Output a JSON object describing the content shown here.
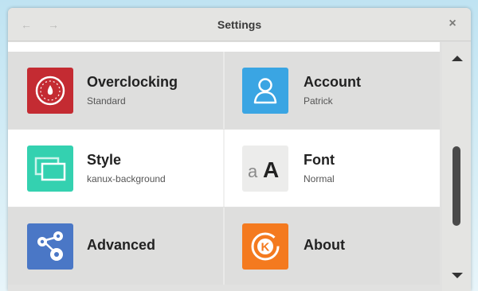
{
  "window": {
    "title": "Settings",
    "back_icon": "back-arrow-icon",
    "forward_icon": "forward-arrow-icon",
    "close_icon": "close-icon"
  },
  "items": [
    {
      "label": "Overclocking",
      "subtitle": "Standard",
      "icon": "speedometer-icon",
      "color": "#c42b32"
    },
    {
      "label": "Account",
      "subtitle": "Patrick",
      "icon": "user-icon",
      "color": "#3aa5e3"
    },
    {
      "label": "Style",
      "subtitle": "kanux-background",
      "icon": "windows-icon",
      "color": "#34d1b0"
    },
    {
      "label": "Font",
      "subtitle": "Normal",
      "icon": "font-size-icon",
      "color": "#ececeb",
      "glyph": "aA"
    },
    {
      "label": "Advanced",
      "subtitle": "",
      "icon": "gears-icon",
      "color": "#4a77c6"
    },
    {
      "label": "About",
      "subtitle": "",
      "icon": "kano-logo-icon",
      "color": "#f47a1f",
      "glyph": "K"
    }
  ],
  "scrollbar": {
    "up_icon": "scroll-up-arrow-icon",
    "down_icon": "scroll-down-arrow-icon"
  }
}
